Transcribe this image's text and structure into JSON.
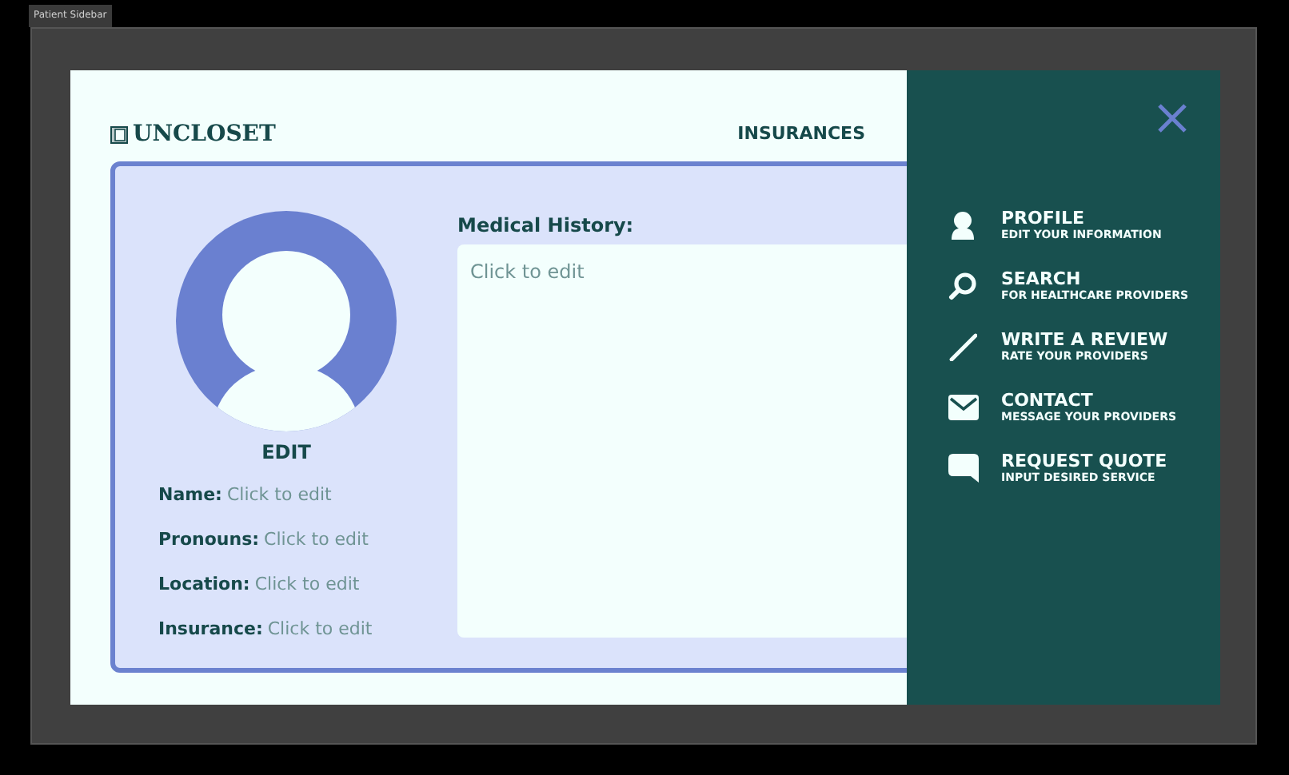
{
  "window": {
    "title": "Patient Sidebar"
  },
  "header": {
    "logo": "UNCLOSET",
    "nav": [
      "INSURANCES"
    ]
  },
  "profile": {
    "edit": "EDIT",
    "fields": [
      {
        "label": "Name:",
        "placeholder": "Click to edit"
      },
      {
        "label": "Pronouns:",
        "placeholder": "Click to edit"
      },
      {
        "label": "Location:",
        "placeholder": "Click to edit"
      },
      {
        "label": "Insurance:",
        "placeholder": "Click to edit"
      }
    ],
    "medical_history": {
      "label": "Medical History:",
      "placeholder": "Click to edit"
    }
  },
  "sidebar": {
    "items": [
      {
        "kind": "profile",
        "title": "PROFILE",
        "subtitle": "EDIT YOUR INFORMATION"
      },
      {
        "kind": "search",
        "title": "SEARCH",
        "subtitle": "FOR HEALTHCARE PROVIDERS"
      },
      {
        "kind": "review",
        "title": "WRITE A REVIEW",
        "subtitle": "RATE YOUR PROVIDERS"
      },
      {
        "kind": "contact",
        "title": "CONTACT",
        "subtitle": "MESSAGE YOUR PROVIDERS"
      },
      {
        "kind": "quote",
        "title": "REQUEST QUOTE",
        "subtitle": "INPUT DESIRED SERVICE"
      }
    ]
  }
}
